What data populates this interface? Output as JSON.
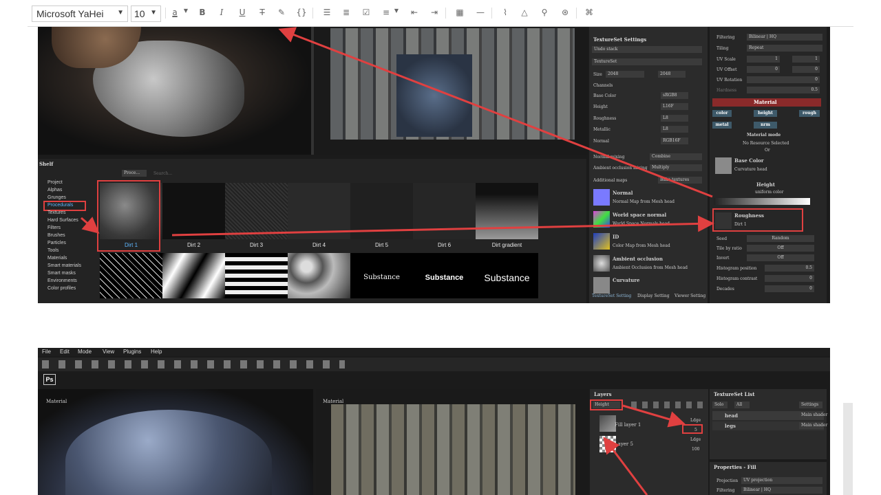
{
  "toolbar": {
    "font_family": "Microsoft YaHei",
    "font_size": "10",
    "icons": [
      "font-color",
      "bold",
      "italic",
      "underline",
      "strikethrough",
      "highlight",
      "code",
      "bullet-list",
      "numbered-list",
      "checklist",
      "align",
      "outdent",
      "indent",
      "table",
      "horizontal-rule",
      "attachment",
      "drive",
      "link",
      "more",
      "fullscreen"
    ]
  },
  "shot1": {
    "viewport_label": "",
    "textureset_settings": {
      "title": "TextureSet Settings",
      "undo_stack": "Undo stack",
      "textureset": "TextureSet",
      "size_label": "Size",
      "size_value": "2048",
      "size_value2": "2048",
      "channels_label": "Channels",
      "channels": [
        {
          "name": "Base Color",
          "format": "sRGB8"
        },
        {
          "name": "Height",
          "format": "L16F"
        },
        {
          "name": "Roughness",
          "format": "L8"
        },
        {
          "name": "Metallic",
          "format": "L8"
        },
        {
          "name": "Normal",
          "format": "RGB16F"
        }
      ],
      "normal_mixing": "Normal mixing",
      "normal_mixing_value": "Combine",
      "ao_mixing": "Ambient occlusion mixing",
      "ao_mixing_value": "Multiply",
      "additional_maps": "Additional maps",
      "additional_maps_btn": "Bake textures",
      "maps": [
        {
          "name": "Normal",
          "desc": "Normal Map from Mesh head"
        },
        {
          "name": "World space normal",
          "desc": "World Space Normals head"
        },
        {
          "name": "ID",
          "desc": "Color Map from Mesh head"
        },
        {
          "name": "Ambient occlusion",
          "desc": "Ambient Occlusion from Mesh head"
        },
        {
          "name": "Curvature",
          "desc": ""
        }
      ],
      "tabs": [
        "TextureSet Setting",
        "Display Setting",
        "Viewer Setting"
      ]
    },
    "properties": {
      "filtering_label": "Filtering",
      "filtering_value": "Bilinear | HQ",
      "tiling_label": "Tiling",
      "tiling_value": "Repeat",
      "uv_scale_label": "UV Scale",
      "uv_scale_value": "1",
      "uv_scale_value2": "1",
      "uv_offset_label": "UV Offset",
      "uv_offset_value": "0",
      "uv_offset_value2": "0",
      "uv_rotation_label": "UV Rotation",
      "uv_rotation_value": "0",
      "hardness_label": "Hardness",
      "hardness_value": "0.5",
      "material_header": "Material",
      "chips": [
        "color",
        "height",
        "rough",
        "metal",
        "nrm"
      ],
      "material_mode": "Material mode",
      "no_resource": "No Resource Selected",
      "or": "Or",
      "base_color": "Base Color",
      "base_color_sub": "Curvature head",
      "height": "Height",
      "height_sub": "uniform color",
      "roughness": "Roughness",
      "roughness_sub": "Dirt 1",
      "seed_label": "Seed",
      "seed_value": "Random",
      "tile_ratio_label": "Tile by ratio",
      "tile_ratio_value": "Off",
      "invert_label": "Invert",
      "invert_value": "Off",
      "hist_pos_label": "Histogram position",
      "hist_pos_value": "0.5",
      "hist_contrast_label": "Histogram contrast",
      "hist_contrast_value": "0",
      "decades_label": "Decades",
      "decades_value": "0"
    },
    "shelf": {
      "title": "Shelf",
      "search_chip": "Proce...",
      "search_placeholder": "Search...",
      "categories": [
        "Project",
        "Alphas",
        "Grunges",
        "Procedurals",
        "Textures",
        "Hard Surfaces",
        "Filters",
        "Brushes",
        "Particles",
        "Tools",
        "Materials",
        "Smart materials",
        "Smart masks",
        "Environments",
        "Color profiles"
      ],
      "items": [
        "Dirt 1",
        "Dirt 2",
        "Dirt 3",
        "Dirt 4",
        "Dirt 5",
        "Dirt 6",
        "Dirt gradient"
      ],
      "items_row2": [
        "",
        "",
        "",
        "",
        "Substance",
        "Substance",
        "Substance"
      ]
    }
  },
  "shot2": {
    "menu": [
      "File",
      "Edit",
      "Mode",
      "View",
      "Plugins",
      "Help"
    ],
    "viewport_left_label": "Material",
    "viewport_right_label": "Material",
    "layers": {
      "title": "Layers",
      "blend": "Height",
      "layer1": "Fill layer 1",
      "layer1_mode": "Ldge",
      "layer1_opacity": "5",
      "layer2": "Layer 5",
      "layer2_mode": "Ldge",
      "layer2_opacity": "100"
    },
    "textureset_list": {
      "title": "TextureSet List",
      "solo": "Solo",
      "all": "All",
      "settings": "Settings",
      "sets": [
        {
          "name": "head",
          "shader": "Main shader"
        },
        {
          "name": "legs",
          "shader": "Main shader"
        }
      ]
    },
    "properties_fill": {
      "title": "Properties - Fill",
      "projection_label": "Projection",
      "projection_value": "UV projection",
      "filtering_label": "Filtering",
      "filtering_value": "Bilinear | HQ"
    }
  },
  "colors": {
    "accent_red": "#e04040",
    "material_header": "#8a2a2a",
    "chip_blue": "#3e5a6a",
    "panel_bg": "#2b2b2b"
  }
}
